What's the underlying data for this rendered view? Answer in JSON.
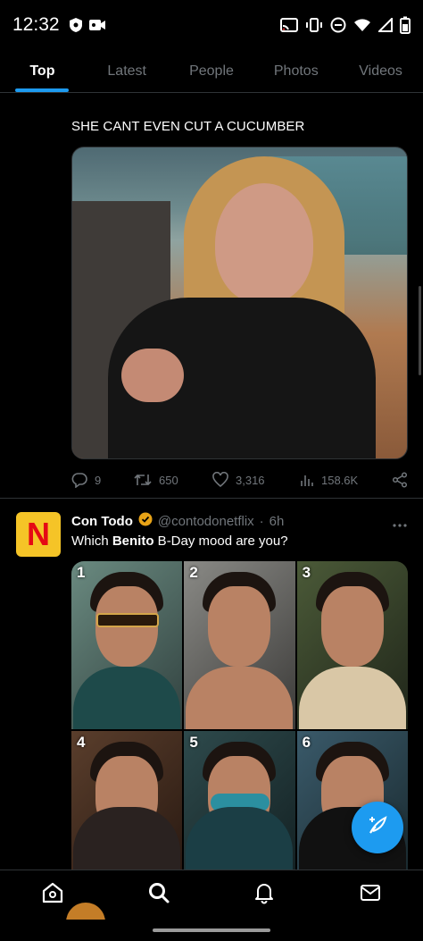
{
  "status_bar": {
    "time": "12:32",
    "icons_left": [
      "shield-icon",
      "video-record-icon"
    ],
    "icons_right": [
      "cast-icon",
      "vibrate-icon",
      "do-not-disturb-icon",
      "wifi-icon",
      "signal-icon",
      "battery-icon"
    ]
  },
  "tabs": [
    {
      "label": "Top",
      "active": true
    },
    {
      "label": "Latest",
      "active": false
    },
    {
      "label": "People",
      "active": false
    },
    {
      "label": "Photos",
      "active": false
    },
    {
      "label": "Videos",
      "active": false
    }
  ],
  "tweet1": {
    "text": "SHE CANT EVEN CUT A CUCUMBER",
    "replies": "9",
    "retweets": "650",
    "likes": "3,316",
    "views": "158.6K"
  },
  "tweet2": {
    "name": "Con Todo",
    "handle": "@contodonetflix",
    "separator": "·",
    "time": "6h",
    "text_before": "Which ",
    "text_bold": "Benito",
    "text_after": " B-Day mood are you?",
    "avatar_letter": "N",
    "grid_numbers": [
      "1",
      "2",
      "3",
      "4",
      "5",
      "6"
    ]
  },
  "colors": {
    "accent": "#1d9bf0",
    "background": "#000000",
    "muted": "#71767b",
    "verified_badge": "#e8a317"
  },
  "bottom_nav": [
    "home-icon",
    "search-icon",
    "notifications-bell-icon",
    "messages-mail-icon"
  ],
  "fab_icon": "compose-feather-icon"
}
